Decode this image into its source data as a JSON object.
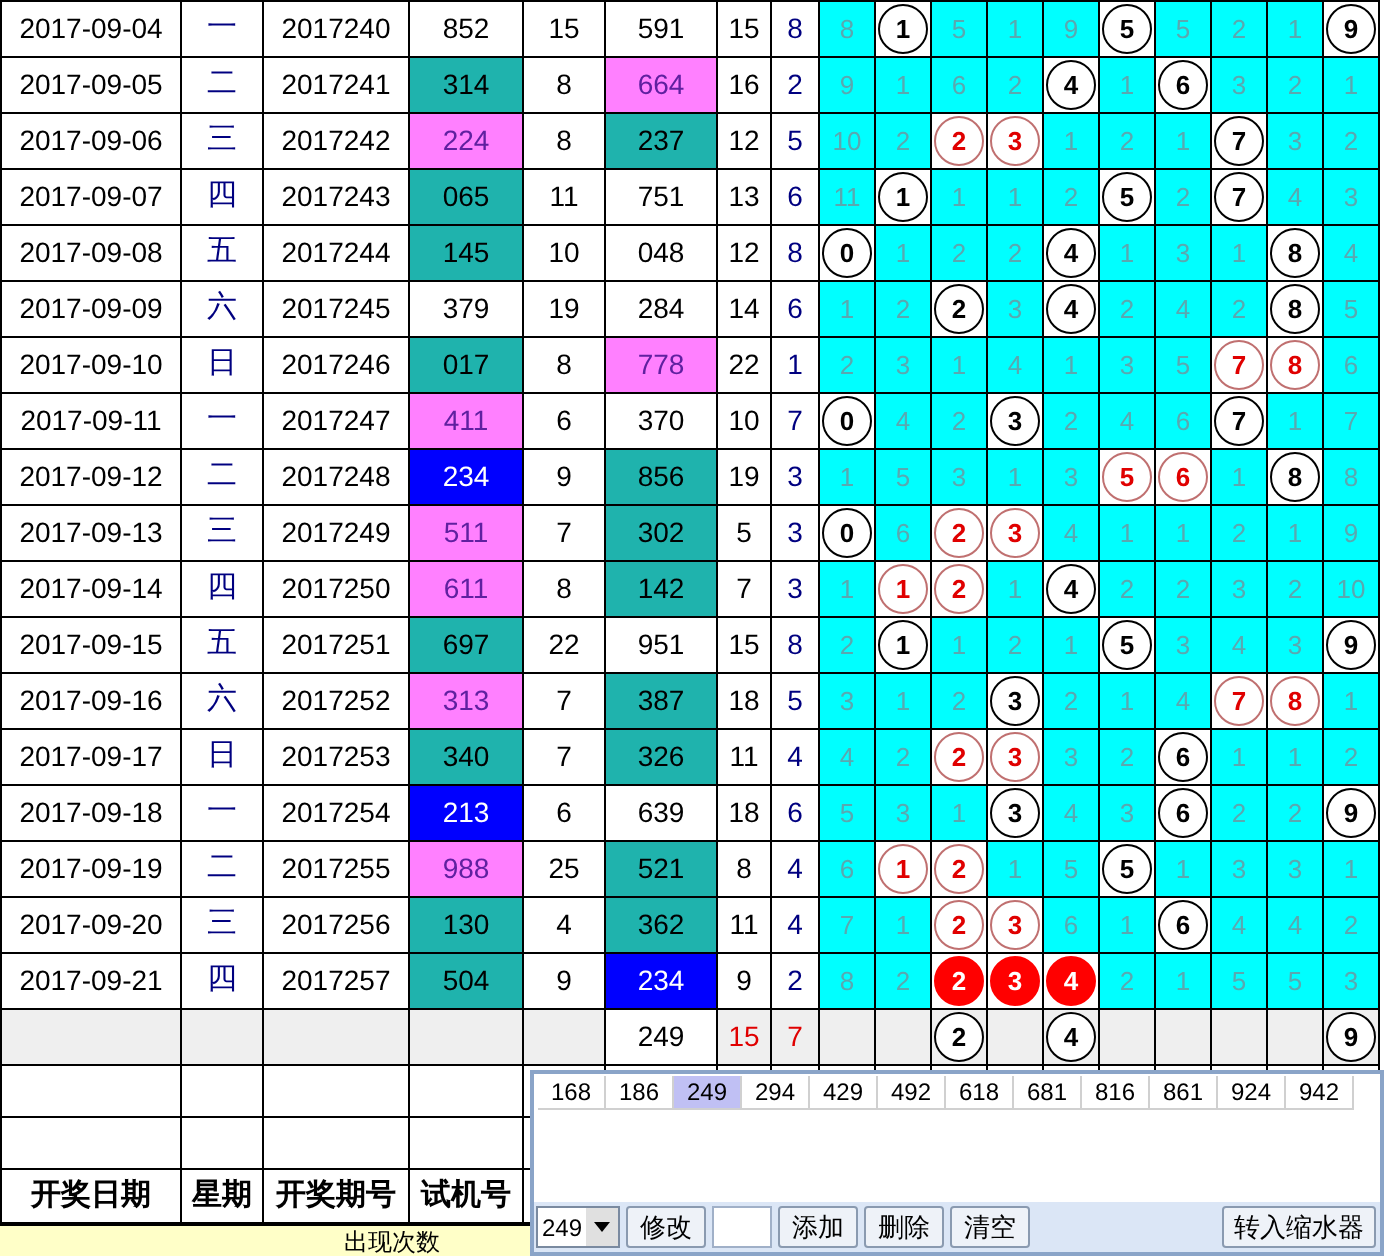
{
  "rows": [
    {
      "date": "2017-09-04",
      "weekday": "一",
      "issue": "2017240",
      "trial": {
        "value": "852"
      },
      "sum": "15",
      "number": {
        "value": "591"
      },
      "span": "15",
      "tail": "8",
      "digits": [
        {
          "value": "8",
          "kind": "plain"
        },
        {
          "value": "1",
          "kind": "circle"
        },
        {
          "value": "5",
          "kind": "plain"
        },
        {
          "value": "1",
          "kind": "plain"
        },
        {
          "value": "9",
          "kind": "plain"
        },
        {
          "value": "5",
          "kind": "circle"
        },
        {
          "value": "5",
          "kind": "plain"
        },
        {
          "value": "2",
          "kind": "plain"
        },
        {
          "value": "1",
          "kind": "plain"
        },
        {
          "value": "9",
          "kind": "circle"
        }
      ]
    },
    {
      "date": "2017-09-05",
      "weekday": "二",
      "issue": "2017241",
      "trial": {
        "value": "314",
        "color": "#1fb3ad"
      },
      "sum": "8",
      "number": {
        "value": "664",
        "color": "#ff80ff"
      },
      "span": "16",
      "tail": "2",
      "digits": [
        {
          "value": "9",
          "kind": "plain"
        },
        {
          "value": "1",
          "kind": "plain"
        },
        {
          "value": "6",
          "kind": "plain"
        },
        {
          "value": "2",
          "kind": "plain"
        },
        {
          "value": "4",
          "kind": "circle"
        },
        {
          "value": "1",
          "kind": "plain"
        },
        {
          "value": "6",
          "kind": "circle"
        },
        {
          "value": "3",
          "kind": "plain"
        },
        {
          "value": "2",
          "kind": "plain"
        },
        {
          "value": "1",
          "kind": "plain"
        }
      ]
    },
    {
      "date": "2017-09-06",
      "weekday": "三",
      "issue": "2017242",
      "trial": {
        "value": "224",
        "color": "#ff80ff"
      },
      "sum": "8",
      "number": {
        "value": "237",
        "color": "#1fb3ad"
      },
      "span": "12",
      "tail": "5",
      "digits": [
        {
          "value": "10",
          "kind": "plain"
        },
        {
          "value": "2",
          "kind": "plain"
        },
        {
          "value": "2",
          "kind": "red_circle"
        },
        {
          "value": "3",
          "kind": "red_circle"
        },
        {
          "value": "1",
          "kind": "plain"
        },
        {
          "value": "2",
          "kind": "plain"
        },
        {
          "value": "1",
          "kind": "plain"
        },
        {
          "value": "7",
          "kind": "circle"
        },
        {
          "value": "3",
          "kind": "plain"
        },
        {
          "value": "2",
          "kind": "plain"
        }
      ]
    },
    {
      "date": "2017-09-07",
      "weekday": "四",
      "issue": "2017243",
      "trial": {
        "value": "065",
        "color": "#1fb3ad"
      },
      "sum": "11",
      "number": {
        "value": "751"
      },
      "span": "13",
      "tail": "6",
      "digits": [
        {
          "value": "11",
          "kind": "plain"
        },
        {
          "value": "1",
          "kind": "circle"
        },
        {
          "value": "1",
          "kind": "plain"
        },
        {
          "value": "1",
          "kind": "plain"
        },
        {
          "value": "2",
          "kind": "plain"
        },
        {
          "value": "5",
          "kind": "circle"
        },
        {
          "value": "2",
          "kind": "plain"
        },
        {
          "value": "7",
          "kind": "circle"
        },
        {
          "value": "4",
          "kind": "plain"
        },
        {
          "value": "3",
          "kind": "plain"
        }
      ]
    },
    {
      "date": "2017-09-08",
      "weekday": "五",
      "issue": "2017244",
      "trial": {
        "value": "145",
        "color": "#1fb3ad"
      },
      "sum": "10",
      "number": {
        "value": "048"
      },
      "span": "12",
      "tail": "8",
      "digits": [
        {
          "value": "0",
          "kind": "circle"
        },
        {
          "value": "1",
          "kind": "plain"
        },
        {
          "value": "2",
          "kind": "plain"
        },
        {
          "value": "2",
          "kind": "plain"
        },
        {
          "value": "4",
          "kind": "circle"
        },
        {
          "value": "1",
          "kind": "plain"
        },
        {
          "value": "3",
          "kind": "plain"
        },
        {
          "value": "1",
          "kind": "plain"
        },
        {
          "value": "8",
          "kind": "circle"
        },
        {
          "value": "4",
          "kind": "plain"
        }
      ]
    },
    {
      "date": "2017-09-09",
      "weekday": "六",
      "issue": "2017245",
      "trial": {
        "value": "379"
      },
      "sum": "19",
      "number": {
        "value": "284"
      },
      "span": "14",
      "tail": "6",
      "digits": [
        {
          "value": "1",
          "kind": "plain"
        },
        {
          "value": "2",
          "kind": "plain"
        },
        {
          "value": "2",
          "kind": "circle"
        },
        {
          "value": "3",
          "kind": "plain"
        },
        {
          "value": "4",
          "kind": "circle"
        },
        {
          "value": "2",
          "kind": "plain"
        },
        {
          "value": "4",
          "kind": "plain"
        },
        {
          "value": "2",
          "kind": "plain"
        },
        {
          "value": "8",
          "kind": "circle"
        },
        {
          "value": "5",
          "kind": "plain"
        }
      ]
    },
    {
      "date": "2017-09-10",
      "weekday": "日",
      "issue": "2017246",
      "trial": {
        "value": "017",
        "color": "#1fb3ad"
      },
      "sum": "8",
      "number": {
        "value": "778",
        "color": "#ff80ff"
      },
      "span": "22",
      "tail": "1",
      "digits": [
        {
          "value": "2",
          "kind": "plain"
        },
        {
          "value": "3",
          "kind": "plain"
        },
        {
          "value": "1",
          "kind": "plain"
        },
        {
          "value": "4",
          "kind": "plain"
        },
        {
          "value": "1",
          "kind": "plain"
        },
        {
          "value": "3",
          "kind": "plain"
        },
        {
          "value": "5",
          "kind": "plain"
        },
        {
          "value": "7",
          "kind": "red_circle"
        },
        {
          "value": "8",
          "kind": "red_circle"
        },
        {
          "value": "6",
          "kind": "plain"
        }
      ]
    },
    {
      "date": "2017-09-11",
      "weekday": "一",
      "issue": "2017247",
      "trial": {
        "value": "411",
        "color": "#ff80ff"
      },
      "sum": "6",
      "number": {
        "value": "370"
      },
      "span": "10",
      "tail": "7",
      "digits": [
        {
          "value": "0",
          "kind": "circle"
        },
        {
          "value": "4",
          "kind": "plain"
        },
        {
          "value": "2",
          "kind": "plain"
        },
        {
          "value": "3",
          "kind": "circle"
        },
        {
          "value": "2",
          "kind": "plain"
        },
        {
          "value": "4",
          "kind": "plain"
        },
        {
          "value": "6",
          "kind": "plain"
        },
        {
          "value": "7",
          "kind": "circle"
        },
        {
          "value": "1",
          "kind": "plain"
        },
        {
          "value": "7",
          "kind": "plain"
        }
      ]
    },
    {
      "date": "2017-09-12",
      "weekday": "二",
      "issue": "2017248",
      "trial": {
        "value": "234",
        "color": "#0000ff"
      },
      "sum": "9",
      "number": {
        "value": "856",
        "color": "#1fb3ad"
      },
      "span": "19",
      "tail": "3",
      "digits": [
        {
          "value": "1",
          "kind": "plain"
        },
        {
          "value": "5",
          "kind": "plain"
        },
        {
          "value": "3",
          "kind": "plain"
        },
        {
          "value": "1",
          "kind": "plain"
        },
        {
          "value": "3",
          "kind": "plain"
        },
        {
          "value": "5",
          "kind": "red_circle"
        },
        {
          "value": "6",
          "kind": "red_circle"
        },
        {
          "value": "1",
          "kind": "plain"
        },
        {
          "value": "8",
          "kind": "circle"
        },
        {
          "value": "8",
          "kind": "plain"
        }
      ]
    },
    {
      "date": "2017-09-13",
      "weekday": "三",
      "issue": "2017249",
      "trial": {
        "value": "511",
        "color": "#ff80ff"
      },
      "sum": "7",
      "number": {
        "value": "302",
        "color": "#1fb3ad"
      },
      "span": "5",
      "tail": "3",
      "digits": [
        {
          "value": "0",
          "kind": "circle"
        },
        {
          "value": "6",
          "kind": "plain"
        },
        {
          "value": "2",
          "kind": "red_circle"
        },
        {
          "value": "3",
          "kind": "red_circle"
        },
        {
          "value": "4",
          "kind": "plain"
        },
        {
          "value": "1",
          "kind": "plain"
        },
        {
          "value": "1",
          "kind": "plain"
        },
        {
          "value": "2",
          "kind": "plain"
        },
        {
          "value": "1",
          "kind": "plain"
        },
        {
          "value": "9",
          "kind": "plain"
        }
      ]
    },
    {
      "date": "2017-09-14",
      "weekday": "四",
      "issue": "2017250",
      "trial": {
        "value": "611",
        "color": "#ff80ff"
      },
      "sum": "8",
      "number": {
        "value": "142",
        "color": "#1fb3ad"
      },
      "span": "7",
      "tail": "3",
      "digits": [
        {
          "value": "1",
          "kind": "plain"
        },
        {
          "value": "1",
          "kind": "red_circle"
        },
        {
          "value": "2",
          "kind": "red_circle"
        },
        {
          "value": "1",
          "kind": "plain"
        },
        {
          "value": "4",
          "kind": "circle"
        },
        {
          "value": "2",
          "kind": "plain"
        },
        {
          "value": "2",
          "kind": "plain"
        },
        {
          "value": "3",
          "kind": "plain"
        },
        {
          "value": "2",
          "kind": "plain"
        },
        {
          "value": "10",
          "kind": "plain"
        }
      ]
    },
    {
      "date": "2017-09-15",
      "weekday": "五",
      "issue": "2017251",
      "trial": {
        "value": "697",
        "color": "#1fb3ad"
      },
      "sum": "22",
      "number": {
        "value": "951"
      },
      "span": "15",
      "tail": "8",
      "digits": [
        {
          "value": "2",
          "kind": "plain"
        },
        {
          "value": "1",
          "kind": "circle"
        },
        {
          "value": "1",
          "kind": "plain"
        },
        {
          "value": "2",
          "kind": "plain"
        },
        {
          "value": "1",
          "kind": "plain"
        },
        {
          "value": "5",
          "kind": "circle"
        },
        {
          "value": "3",
          "kind": "plain"
        },
        {
          "value": "4",
          "kind": "plain"
        },
        {
          "value": "3",
          "kind": "plain"
        },
        {
          "value": "9",
          "kind": "circle"
        }
      ]
    },
    {
      "date": "2017-09-16",
      "weekday": "六",
      "issue": "2017252",
      "trial": {
        "value": "313",
        "color": "#ff80ff"
      },
      "sum": "7",
      "number": {
        "value": "387",
        "color": "#1fb3ad"
      },
      "span": "18",
      "tail": "5",
      "digits": [
        {
          "value": "3",
          "kind": "plain"
        },
        {
          "value": "1",
          "kind": "plain"
        },
        {
          "value": "2",
          "kind": "plain"
        },
        {
          "value": "3",
          "kind": "circle"
        },
        {
          "value": "2",
          "kind": "plain"
        },
        {
          "value": "1",
          "kind": "plain"
        },
        {
          "value": "4",
          "kind": "plain"
        },
        {
          "value": "7",
          "kind": "red_circle"
        },
        {
          "value": "8",
          "kind": "red_circle"
        },
        {
          "value": "1",
          "kind": "plain"
        }
      ]
    },
    {
      "date": "2017-09-17",
      "weekday": "日",
      "issue": "2017253",
      "trial": {
        "value": "340",
        "color": "#1fb3ad"
      },
      "sum": "7",
      "number": {
        "value": "326",
        "color": "#1fb3ad"
      },
      "span": "11",
      "tail": "4",
      "digits": [
        {
          "value": "4",
          "kind": "plain"
        },
        {
          "value": "2",
          "kind": "plain"
        },
        {
          "value": "2",
          "kind": "red_circle"
        },
        {
          "value": "3",
          "kind": "red_circle"
        },
        {
          "value": "3",
          "kind": "plain"
        },
        {
          "value": "2",
          "kind": "plain"
        },
        {
          "value": "6",
          "kind": "circle"
        },
        {
          "value": "1",
          "kind": "plain"
        },
        {
          "value": "1",
          "kind": "plain"
        },
        {
          "value": "2",
          "kind": "plain"
        }
      ]
    },
    {
      "date": "2017-09-18",
      "weekday": "一",
      "issue": "2017254",
      "trial": {
        "value": "213",
        "color": "#0000ff"
      },
      "sum": "6",
      "number": {
        "value": "639"
      },
      "span": "18",
      "tail": "6",
      "digits": [
        {
          "value": "5",
          "kind": "plain"
        },
        {
          "value": "3",
          "kind": "plain"
        },
        {
          "value": "1",
          "kind": "plain"
        },
        {
          "value": "3",
          "kind": "circle"
        },
        {
          "value": "4",
          "kind": "plain"
        },
        {
          "value": "3",
          "kind": "plain"
        },
        {
          "value": "6",
          "kind": "circle"
        },
        {
          "value": "2",
          "kind": "plain"
        },
        {
          "value": "2",
          "kind": "plain"
        },
        {
          "value": "9",
          "kind": "circle"
        }
      ]
    },
    {
      "date": "2017-09-19",
      "weekday": "二",
      "issue": "2017255",
      "trial": {
        "value": "988",
        "color": "#ff80ff"
      },
      "sum": "25",
      "number": {
        "value": "521",
        "color": "#1fb3ad"
      },
      "span": "8",
      "tail": "4",
      "digits": [
        {
          "value": "6",
          "kind": "plain"
        },
        {
          "value": "1",
          "kind": "red_circle"
        },
        {
          "value": "2",
          "kind": "red_circle"
        },
        {
          "value": "1",
          "kind": "plain"
        },
        {
          "value": "5",
          "kind": "plain"
        },
        {
          "value": "5",
          "kind": "circle"
        },
        {
          "value": "1",
          "kind": "plain"
        },
        {
          "value": "3",
          "kind": "plain"
        },
        {
          "value": "3",
          "kind": "plain"
        },
        {
          "value": "1",
          "kind": "plain"
        }
      ]
    },
    {
      "date": "2017-09-20",
      "weekday": "三",
      "issue": "2017256",
      "trial": {
        "value": "130",
        "color": "#1fb3ad"
      },
      "sum": "4",
      "number": {
        "value": "362",
        "color": "#1fb3ad"
      },
      "span": "11",
      "tail": "4",
      "digits": [
        {
          "value": "7",
          "kind": "plain"
        },
        {
          "value": "1",
          "kind": "plain"
        },
        {
          "value": "2",
          "kind": "red_circle"
        },
        {
          "value": "3",
          "kind": "red_circle"
        },
        {
          "value": "6",
          "kind": "plain"
        },
        {
          "value": "1",
          "kind": "plain"
        },
        {
          "value": "6",
          "kind": "circle"
        },
        {
          "value": "4",
          "kind": "plain"
        },
        {
          "value": "4",
          "kind": "plain"
        },
        {
          "value": "2",
          "kind": "plain"
        }
      ]
    },
    {
      "date": "2017-09-21",
      "weekday": "四",
      "issue": "2017257",
      "trial": {
        "value": "504",
        "color": "#1fb3ad"
      },
      "sum": "9",
      "number": {
        "value": "234",
        "color": "#0000ff"
      },
      "span": "9",
      "tail": "2",
      "digits": [
        {
          "value": "8",
          "kind": "plain"
        },
        {
          "value": "2",
          "kind": "plain"
        },
        {
          "value": "2",
          "kind": "red_filled"
        },
        {
          "value": "3",
          "kind": "red_filled"
        },
        {
          "value": "4",
          "kind": "red_filled"
        },
        {
          "value": "2",
          "kind": "plain"
        },
        {
          "value": "1",
          "kind": "plain"
        },
        {
          "value": "5",
          "kind": "plain"
        },
        {
          "value": "5",
          "kind": "plain"
        },
        {
          "value": "3",
          "kind": "plain"
        }
      ]
    }
  ],
  "summary": {
    "number": "249",
    "span": "15",
    "tail": "7",
    "digits": [
      {
        "kind": "blank"
      },
      {
        "kind": "blank"
      },
      {
        "value": "2",
        "kind": "circle"
      },
      {
        "kind": "blank"
      },
      {
        "value": "4",
        "kind": "circle"
      },
      {
        "kind": "blank"
      },
      {
        "kind": "blank"
      },
      {
        "kind": "blank"
      },
      {
        "kind": "blank"
      },
      {
        "value": "9",
        "kind": "circle"
      }
    ]
  },
  "header": [
    "开奖日期",
    "星期",
    "开奖期号",
    "试机号"
  ],
  "footer_label": "出现次数",
  "panel": {
    "numbers": [
      {
        "label": "168",
        "selected": false
      },
      {
        "label": "186",
        "selected": false
      },
      {
        "label": "249",
        "selected": true
      },
      {
        "label": "294",
        "selected": false
      },
      {
        "label": "429",
        "selected": false
      },
      {
        "label": "492",
        "selected": false
      },
      {
        "label": "618",
        "selected": false
      },
      {
        "label": "681",
        "selected": false
      },
      {
        "label": "816",
        "selected": false
      },
      {
        "label": "861",
        "selected": false
      },
      {
        "label": "924",
        "selected": false
      },
      {
        "label": "942",
        "selected": false
      }
    ],
    "toolbar": [
      {
        "kind": "combo",
        "value": "249"
      },
      {
        "kind": "button",
        "label": "修改"
      },
      {
        "kind": "input"
      },
      {
        "kind": "button",
        "label": "添加"
      },
      {
        "kind": "button",
        "label": "删除"
      },
      {
        "kind": "button",
        "label": "清空"
      }
    ],
    "right_button": "转入缩水器"
  }
}
